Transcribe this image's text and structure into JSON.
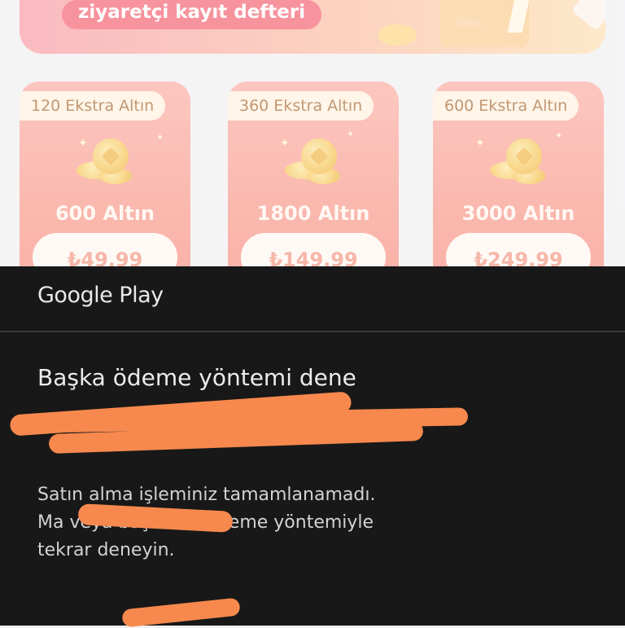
{
  "banner": {
    "label": "ziyaretçi kayıt defteri",
    "watermark": "Web..."
  },
  "packages": [
    {
      "bonus": "120 Ekstra Altın",
      "amount": "600 Altın",
      "price": "₺49.99"
    },
    {
      "bonus": "360 Ekstra Altın",
      "amount": "1800 Altın",
      "price": "₺149.99"
    },
    {
      "bonus": "600 Ekstra Altın",
      "amount": "3000 Altın",
      "price": "₺249.99"
    }
  ],
  "dialog": {
    "brand": "Google Play",
    "title": "Başka ödeme yöntemi dene",
    "message_line1": "Satın alma işleminiz tamamlanamadı.",
    "message_line2": "Ma                        veya başka bir ödeme yöntemiyle",
    "message_line3": "tekrar deneyin."
  },
  "colors": {
    "sheet_background": "#181818",
    "redaction": "#f7894e",
    "card_gradient_top": "#fbb2a8",
    "price_text": "#f39a87"
  }
}
